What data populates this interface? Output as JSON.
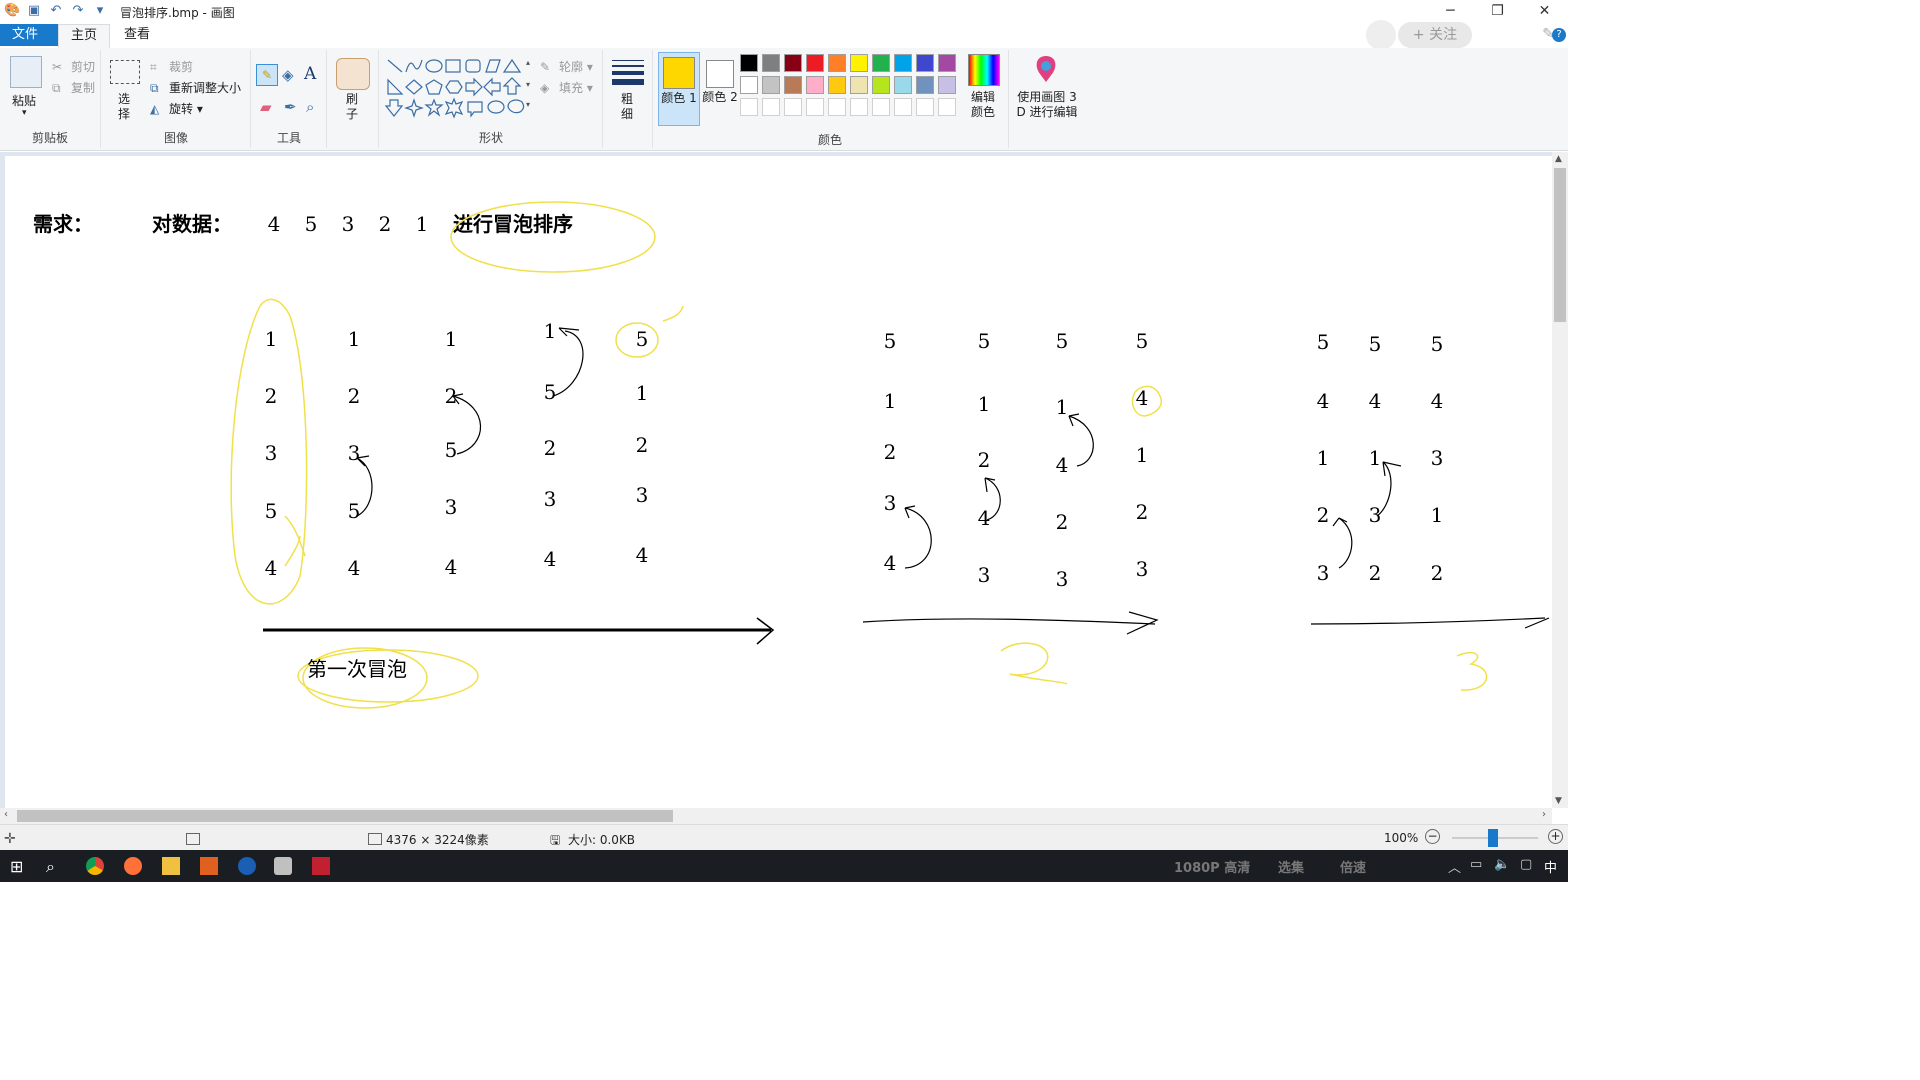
{
  "window": {
    "title": "冒泡排序.bmp - 画图"
  },
  "tabs": {
    "file": "文件",
    "home": "主页",
    "view": "查看"
  },
  "follow": {
    "label": "+ 关注"
  },
  "ribbon": {
    "clipboard": {
      "label": "剪贴板",
      "paste": "粘贴",
      "cut": "剪切",
      "copy": "复制"
    },
    "image": {
      "label": "图像",
      "select": "选择",
      "crop": "裁剪",
      "resize": "重新调整大小",
      "rotate": "旋转"
    },
    "tools": {
      "label": "工具"
    },
    "brush": {
      "label": "刷子"
    },
    "shapes": {
      "label": "形状",
      "outline": "轮廓",
      "fill": "填充"
    },
    "size": {
      "label": "粗细"
    },
    "color1": {
      "label": "颜色 1"
    },
    "color2": {
      "label": "颜色 2"
    },
    "colors": {
      "label": "颜色",
      "edit": "编辑颜色"
    },
    "paint3d": {
      "label": "使用画图 3 D 进行编辑"
    }
  },
  "palette": [
    "#000000",
    "#7f7f7f",
    "#880015",
    "#ed1c24",
    "#ff7f27",
    "#fff200",
    "#22b14c",
    "#00a2e8",
    "#3f48cc",
    "#a349a4",
    "#ffffff",
    "#c3c3c3",
    "#b97a57",
    "#ffaec9",
    "#ffc90e",
    "#efe4b0",
    "#b5e61d",
    "#99d9ea",
    "#7092be",
    "#c8bfe7"
  ],
  "primary_color": "#ffd700",
  "canvas": {
    "need": "需求：",
    "data_label": "对数据：",
    "data": [
      "4",
      "5",
      "3",
      "2",
      "1"
    ],
    "task": "进行冒泡排序",
    "pass1_label": "第一次冒泡",
    "pass1": [
      [
        "1",
        "2",
        "3",
        "5",
        "4"
      ],
      [
        "1",
        "2",
        "3",
        "5",
        "4"
      ],
      [
        "1",
        "2",
        "5",
        "3",
        "4"
      ],
      [
        "1",
        "5",
        "2",
        "3",
        "4"
      ],
      [
        "5",
        "1",
        "2",
        "3",
        "4"
      ]
    ],
    "pass2": [
      [
        "5",
        "1",
        "2",
        "3",
        "4"
      ],
      [
        "5",
        "1",
        "2",
        "4",
        "3"
      ],
      [
        "5",
        "1",
        "4",
        "2",
        "3"
      ],
      [
        "5",
        "4",
        "1",
        "2",
        "3"
      ]
    ],
    "pass3": [
      [
        "5",
        "4",
        "1",
        "2",
        "3"
      ],
      [
        "5",
        "4",
        "1",
        "3",
        "2"
      ],
      [
        "5",
        "4",
        "3",
        "1",
        "2"
      ]
    ],
    "pass2_mark": "2",
    "pass3_mark": "3"
  },
  "status": {
    "dimensions": "4376 × 3224像素",
    "size": "大小: 0.0KB",
    "zoom": "100%"
  },
  "taskbar": {
    "ime": "中",
    "quality": "1080P 高清",
    "select": "选集",
    "speed": "倍速"
  }
}
